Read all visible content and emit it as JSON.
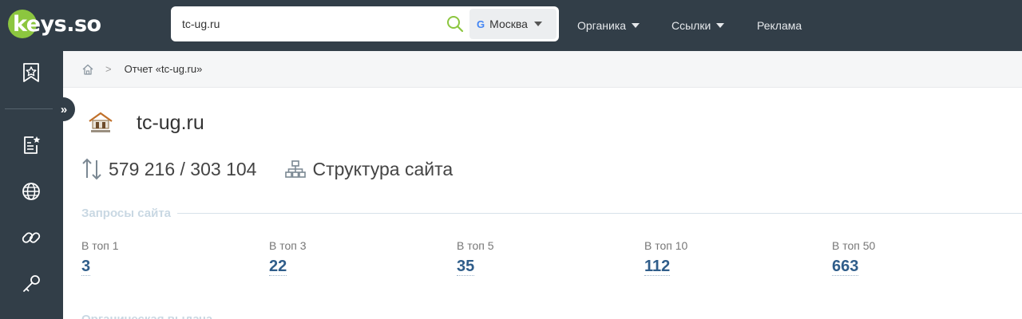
{
  "brand": {
    "logo_text": "keys.so"
  },
  "search": {
    "value": "tc-ug.ru",
    "region": "Москва"
  },
  "topnav": {
    "organic": "Органика",
    "links": "Ссылки",
    "ads": "Реклама"
  },
  "breadcrumb": {
    "current": "Отчет «tc-ug.ru»"
  },
  "site": {
    "domain": "tc-ug.ru",
    "visits": "579 216 / 303 104",
    "structure_label": "Структура сайта"
  },
  "queries_section": {
    "title": "Запросы сайта",
    "metrics": [
      {
        "label": "В топ 1",
        "value": "3"
      },
      {
        "label": "В топ 3",
        "value": "22"
      },
      {
        "label": "В топ 5",
        "value": "35"
      },
      {
        "label": "В топ 10",
        "value": "112"
      },
      {
        "label": "В топ 50",
        "value": "663"
      }
    ]
  },
  "next_section": {
    "title": "Органическая выдача"
  },
  "icons": {
    "sidebar": [
      "bookmark-star-icon",
      "report-star-icon",
      "globe-icon",
      "link-icon",
      "key-icon"
    ],
    "collapse": "double-chevron-right-icon"
  },
  "colors": {
    "topbar": "#323e48",
    "accent_green": "#8cc63f",
    "metric_value": "#2f5d8a"
  }
}
